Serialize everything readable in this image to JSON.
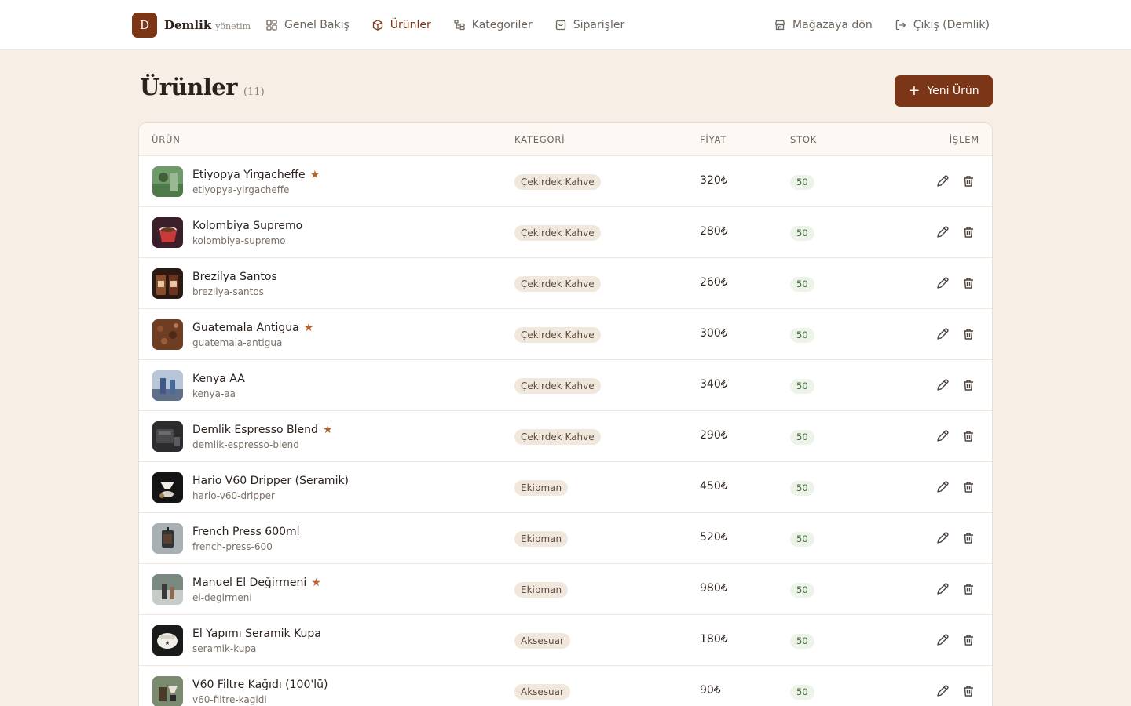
{
  "brand": {
    "initial": "D",
    "name": "Demlik",
    "sub": "yönetim"
  },
  "nav": {
    "overview": "Genel Bakış",
    "products": "Ürünler",
    "categories": "Kategoriler",
    "orders": "Siparişler",
    "store": "Mağazaya dön",
    "logout": "Çıkış (Demlik)"
  },
  "header": {
    "title": "Ürünler",
    "count": "(11)",
    "new_button": "Yeni Ürün"
  },
  "table": {
    "columns": {
      "product": "ÜRÜN",
      "category": "KATEGORİ",
      "price": "FİYAT",
      "stock": "STOK",
      "action": "İŞLEM"
    },
    "rows": [
      {
        "name": "Etiyopya Yirgacheffe",
        "slug": "etiyopya-yirgacheffe",
        "featured": true,
        "category": "Çekirdek Kahve",
        "price": "320₺",
        "stock": "50"
      },
      {
        "name": "Kolombiya Supremo",
        "slug": "kolombiya-supremo",
        "featured": false,
        "category": "Çekirdek Kahve",
        "price": "280₺",
        "stock": "50"
      },
      {
        "name": "Brezilya Santos",
        "slug": "brezilya-santos",
        "featured": false,
        "category": "Çekirdek Kahve",
        "price": "260₺",
        "stock": "50"
      },
      {
        "name": "Guatemala Antigua",
        "slug": "guatemala-antigua",
        "featured": true,
        "category": "Çekirdek Kahve",
        "price": "300₺",
        "stock": "50"
      },
      {
        "name": "Kenya AA",
        "slug": "kenya-aa",
        "featured": false,
        "category": "Çekirdek Kahve",
        "price": "340₺",
        "stock": "50"
      },
      {
        "name": "Demlik Espresso Blend",
        "slug": "demlik-espresso-blend",
        "featured": true,
        "category": "Çekirdek Kahve",
        "price": "290₺",
        "stock": "50"
      },
      {
        "name": "Hario V60 Dripper (Seramik)",
        "slug": "hario-v60-dripper",
        "featured": false,
        "category": "Ekipman",
        "price": "450₺",
        "stock": "50"
      },
      {
        "name": "French Press 600ml",
        "slug": "french-press-600",
        "featured": false,
        "category": "Ekipman",
        "price": "520₺",
        "stock": "50"
      },
      {
        "name": "Manuel El Değirmeni",
        "slug": "el-degirmeni",
        "featured": true,
        "category": "Ekipman",
        "price": "980₺",
        "stock": "50"
      },
      {
        "name": "El Yapımı Seramik Kupa",
        "slug": "seramik-kupa",
        "featured": false,
        "category": "Aksesuar",
        "price": "180₺",
        "stock": "50"
      },
      {
        "name": "V60 Filtre Kağıdı (100'lü)",
        "slug": "v60-filtre-kagidi",
        "featured": false,
        "category": "Aksesuar",
        "price": "90₺",
        "stock": "50"
      }
    ]
  },
  "colors": {
    "brand": "#7b3517",
    "background": "#f7efe6",
    "star": "#b5622d",
    "stock_badge": "#eef3ea"
  },
  "icons": {
    "edit": "pencil-icon",
    "delete": "trash-icon",
    "featured": "star-icon"
  }
}
